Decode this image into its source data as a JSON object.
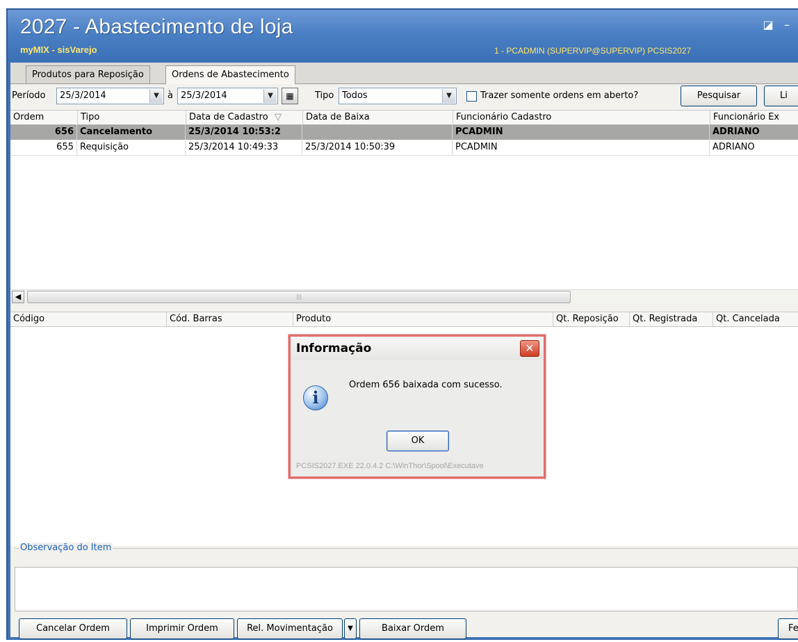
{
  "window": {
    "title": "2027 - Abastecimento de loja",
    "subtitle": "myMIX - sisVarejo",
    "user_info": "1 - PCADMIN (SUPERVIP@SUPERVIP)  PCSIS2027"
  },
  "tabs": [
    {
      "label": "Produtos para Reposição"
    },
    {
      "label": "Ordens de Abastecimento"
    }
  ],
  "filter": {
    "periodo_label": "Período",
    "data_inicio": "25/3/2014",
    "a_label": "à",
    "data_fim": "25/3/2014",
    "tipo_label": "Tipo",
    "tipo_value": "Todos",
    "checkbox_label": "Trazer somente ordens em aberto?",
    "pesquisar_label": "Pesquisar",
    "limpar_label": "Li"
  },
  "orders_grid": {
    "columns": [
      "Ordem",
      "Tipo",
      "Data de Cadastro",
      "Data de Baixa",
      "Funcionário Cadastro",
      "Funcionário Ex"
    ],
    "sort_indicator": "▽",
    "rows": [
      {
        "ordem": "656",
        "tipo": "Cancelamento",
        "data_cadastro": "25/3/2014 10:53:2",
        "data_baixa": "",
        "func_cadastro": "PCADMIN",
        "func_ex": "ADRIANO"
      },
      {
        "ordem": "655",
        "tipo": "Requisição",
        "data_cadastro": "25/3/2014 10:49:33",
        "data_baixa": "25/3/2014 10:50:39",
        "func_cadastro": "PCADMIN",
        "func_ex": "ADRIANO"
      }
    ]
  },
  "items_grid": {
    "columns": [
      "Código",
      "Cód. Barras",
      "Produto",
      "Qt. Reposição",
      "Qt. Registrada",
      "Qt. Cancelada"
    ]
  },
  "observacao": {
    "legend": "Observação do Item",
    "value": ""
  },
  "footer": {
    "cancelar": "Cancelar Ordem",
    "imprimir": "Imprimir Ordem",
    "rel_mov": "Rel. Movimentação",
    "baixar": "Baixar Ordem",
    "fechar": "Fe"
  },
  "dialog": {
    "title": "Informação",
    "message": "Ordem 656 baixada com sucesso.",
    "ok_label": "OK",
    "status": "PCSIS2027.EXE 22.0.4.2 C:\\WinThor\\Spool\\Executave",
    "icon": "info-icon"
  },
  "colors": {
    "title_bg": "#4a7fc4",
    "subtitle": "#ffe76a",
    "selected_row": "#a7a7a5",
    "dialog_border": "#e06d6d",
    "close_button": "#cf3c22"
  }
}
